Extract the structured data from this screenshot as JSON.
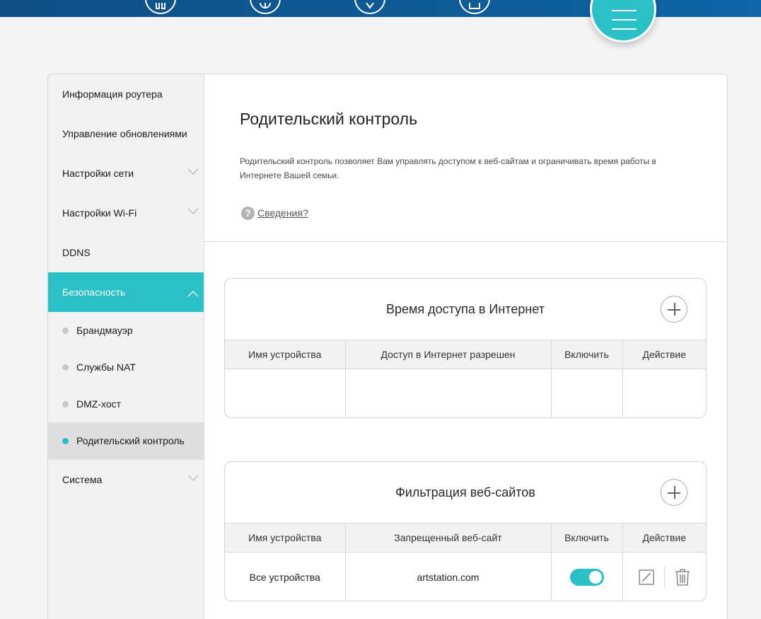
{
  "sidebar": {
    "items": [
      {
        "label": "Информация роутера"
      },
      {
        "label": "Управление обновлениями"
      },
      {
        "label": "Настройки сети"
      },
      {
        "label": "Настройки Wi-Fi"
      },
      {
        "label": "DDNS"
      },
      {
        "label": "Безопасность"
      }
    ],
    "security_sub": [
      {
        "label": "Брандмауэр"
      },
      {
        "label": "Службы NAT"
      },
      {
        "label": "DMZ-хост"
      },
      {
        "label": "Родительский контроль"
      }
    ],
    "system": {
      "label": "Система"
    }
  },
  "page": {
    "title": "Родительский контроль",
    "description": "Родительский контроль позволяет Вам управлять доступом к веб-сайтам и ограничивать время работы в Интернете Вашей семьи.",
    "help_link": "Сведения?",
    "help_symbol": "?"
  },
  "internet_time": {
    "title": "Время доступа в Интернет",
    "headers": [
      "Имя устройства",
      "Доступ в Интернет разрешен",
      "Включить",
      "Действие"
    ]
  },
  "web_filter": {
    "title": "Фильтрация веб-сайтов",
    "headers": [
      "Имя устройства",
      "Запрещенный веб-сайт",
      "Включить",
      "Действие"
    ],
    "rows": [
      {
        "device": "Все устройства",
        "site": "artstation.com",
        "enabled": true
      }
    ]
  },
  "colors": {
    "accent": "#2bbfc6",
    "topbar": "#0e5a95"
  }
}
